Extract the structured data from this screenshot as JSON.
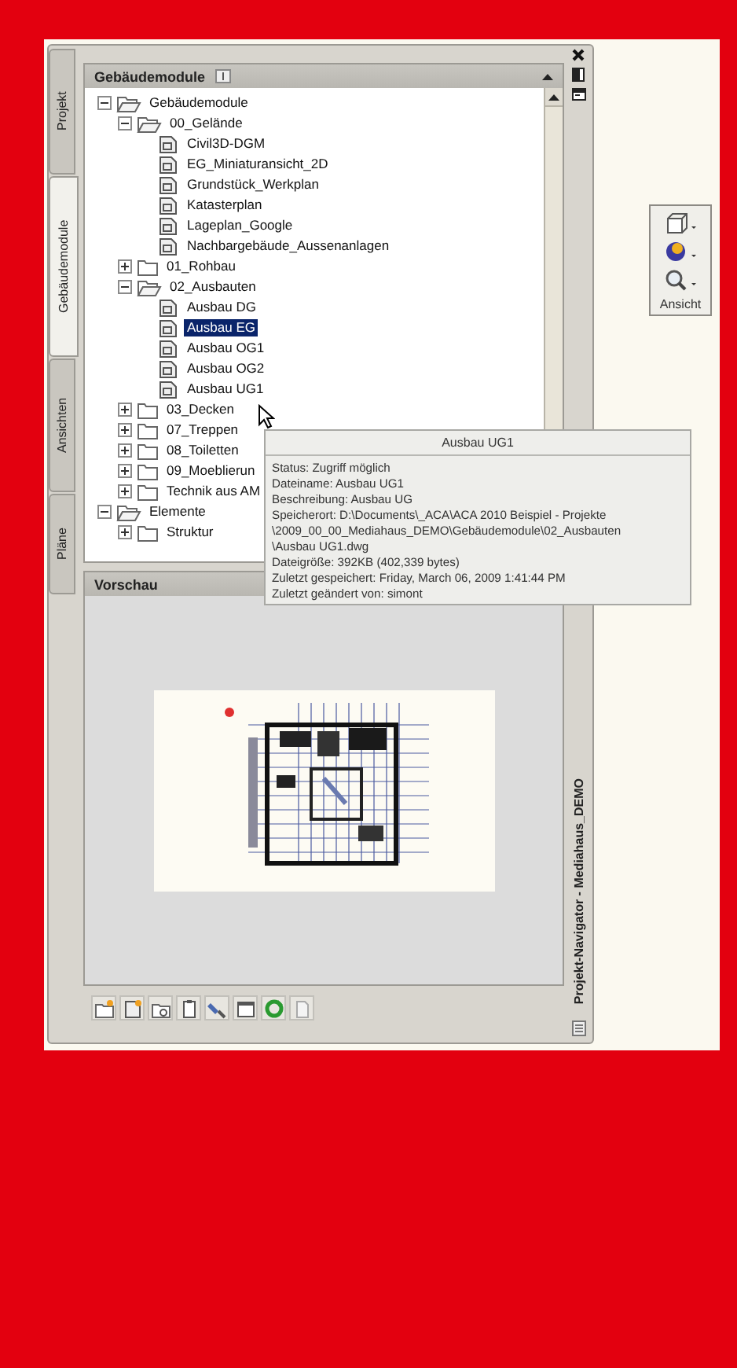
{
  "tabs": [
    {
      "label": "Projekt",
      "selected": false
    },
    {
      "label": "Gebäudemodule",
      "selected": true
    },
    {
      "label": "Ansichten",
      "selected": false
    },
    {
      "label": "Pläne",
      "selected": false
    }
  ],
  "tree_panel": {
    "title": "Gebäudemodule"
  },
  "tree": [
    {
      "label": "Gebäudemodule",
      "kind": "folder",
      "expanded": true,
      "selected": false,
      "children": [
        {
          "label": "00_Gelände",
          "kind": "folder",
          "expanded": true,
          "selected": false,
          "children": [
            {
              "label": "Civil3D-DGM",
              "kind": "file",
              "selected": false
            },
            {
              "label": "EG_Miniaturansicht_2D",
              "kind": "file",
              "selected": false
            },
            {
              "label": "Grundstück_Werkplan",
              "kind": "file",
              "selected": false
            },
            {
              "label": "Katasterplan",
              "kind": "file",
              "selected": false
            },
            {
              "label": "Lageplan_Google",
              "kind": "file",
              "selected": false
            },
            {
              "label": "Nachbargebäude_Aussenanlagen",
              "kind": "file",
              "selected": false
            }
          ]
        },
        {
          "label": "01_Rohbau",
          "kind": "folder",
          "expanded": false,
          "selected": false
        },
        {
          "label": "02_Ausbauten",
          "kind": "folder",
          "expanded": true,
          "selected": false,
          "children": [
            {
              "label": "Ausbau DG",
              "kind": "file",
              "selected": false
            },
            {
              "label": "Ausbau EG",
              "kind": "file",
              "selected": true
            },
            {
              "label": "Ausbau OG1",
              "kind": "file",
              "selected": false
            },
            {
              "label": "Ausbau OG2",
              "kind": "file",
              "selected": false
            },
            {
              "label": "Ausbau UG1",
              "kind": "file",
              "selected": false
            }
          ]
        },
        {
          "label": "03_Decken",
          "kind": "folder",
          "expanded": false,
          "selected": false
        },
        {
          "label": "07_Treppen",
          "kind": "folder",
          "expanded": false,
          "selected": false
        },
        {
          "label": "08_Toiletten",
          "kind": "folder",
          "expanded": false,
          "selected": false
        },
        {
          "label": "09_Moeblierun",
          "kind": "folder",
          "expanded": false,
          "selected": false
        },
        {
          "label": "Technik aus AM",
          "kind": "folder",
          "expanded": false,
          "selected": false
        }
      ]
    },
    {
      "label": "Elemente",
      "kind": "folder",
      "expanded": true,
      "selected": false,
      "children": [
        {
          "label": "Struktur",
          "kind": "folder",
          "expanded": false,
          "selected": false
        }
      ]
    }
  ],
  "tooltip": {
    "title": "Ausbau UG1",
    "lines": [
      "Status: Zugriff möglich",
      "Dateiname: Ausbau UG1",
      "Beschreibung: Ausbau UG",
      "Speicherort: D:\\Documents\\_ACA\\ACA 2010 Beispiel - Projekte",
      "\\2009_00_00_Mediahaus_DEMO\\Gebäudemodule\\02_Ausbauten",
      "\\Ausbau UG1.dwg",
      "Dateigröße: 392KB (402,339 bytes)",
      "Zuletzt gespeichert: Friday, March 06, 2009  1:41:44 PM",
      "Zuletzt geändert von: simont"
    ]
  },
  "preview": {
    "title": "Vorschau"
  },
  "side_title": "Projekt-Navigator - Mediahaus_DEMO",
  "view_toolbar": {
    "label": "Ansicht"
  }
}
